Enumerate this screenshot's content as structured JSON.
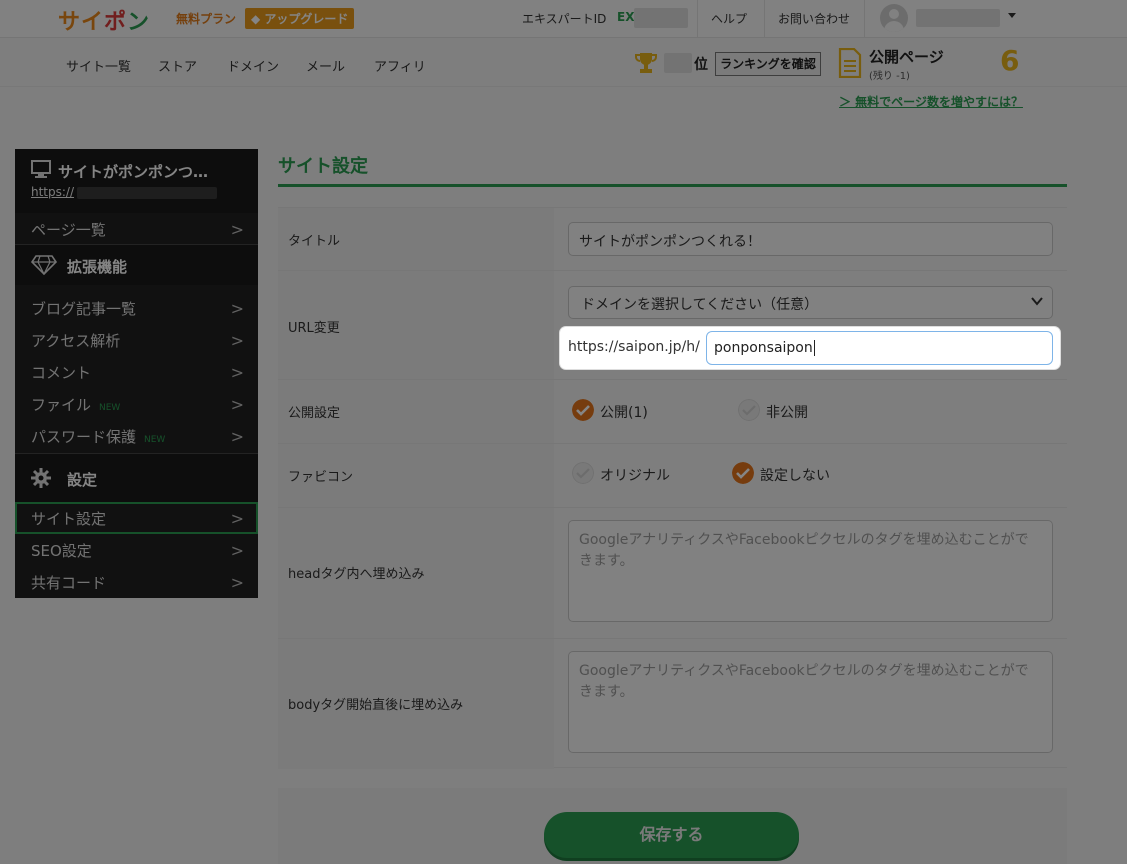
{
  "header": {
    "logo": {
      "part1": "サイ",
      "part2": "ポ",
      "part3": "ン"
    },
    "plan": "無料プラン",
    "upgrade": "アップグレード",
    "expert_id_label": "エキスパートID",
    "expert_id_prefix": "EX",
    "help": "ヘルプ",
    "contact": "お問い合わせ"
  },
  "nav": {
    "items": [
      "サイト一覧",
      "ストア",
      "ドメイン",
      "メール",
      "アフィリ"
    ],
    "rank_suffix": "位",
    "rank_button": "ランキングを確認",
    "published_title": "公開ページ",
    "published_remaining": "(残り -1)",
    "published_count": "6",
    "more_link": "＞ 無料でページ数を増やすには？"
  },
  "sidebar": {
    "site_title": "サイトがポンポンつ…",
    "site_url": "https://",
    "pages": "ページ一覧",
    "extensions_title": "拡張機能",
    "ext_items": [
      "ブログ記事一覧",
      "アクセス解析",
      "コメント",
      "ファイル",
      "パスワード保護"
    ],
    "new_badge": "NEW",
    "settings_title": "設定",
    "settings_items": [
      "サイト設定",
      "SEO設定",
      "共有コード"
    ]
  },
  "main": {
    "title": "サイト設定",
    "title_label": "タイトル",
    "title_value": "サイトがポンポンつくれる！",
    "url_label": "URL変更",
    "domain_select": "ドメインを選択してください（任意）",
    "url_prefix": "https://saipon.jp/h/",
    "url_value": "ponponsaipon",
    "public_label": "公開設定",
    "public_on": "公開(1)",
    "public_off": "非公開",
    "favicon_label": "ファビコン",
    "favicon_original": "オリジナル",
    "favicon_none": "設定しない",
    "head_label": "headタグ内へ埋め込み",
    "head_placeholder": "GoogleアナリティクスやFacebookピクセルのタグを埋め込むことができます。",
    "body_label": "bodyタグ開始直後に埋め込み",
    "body_placeholder": "GoogleアナリティクスやFacebookピクセルのタグを埋め込むことができます。",
    "save": "保存する"
  },
  "colors": {
    "brand_green": "#2b9b52",
    "accent_orange": "#e2741c",
    "trophy_gold": "#e7b21c"
  }
}
